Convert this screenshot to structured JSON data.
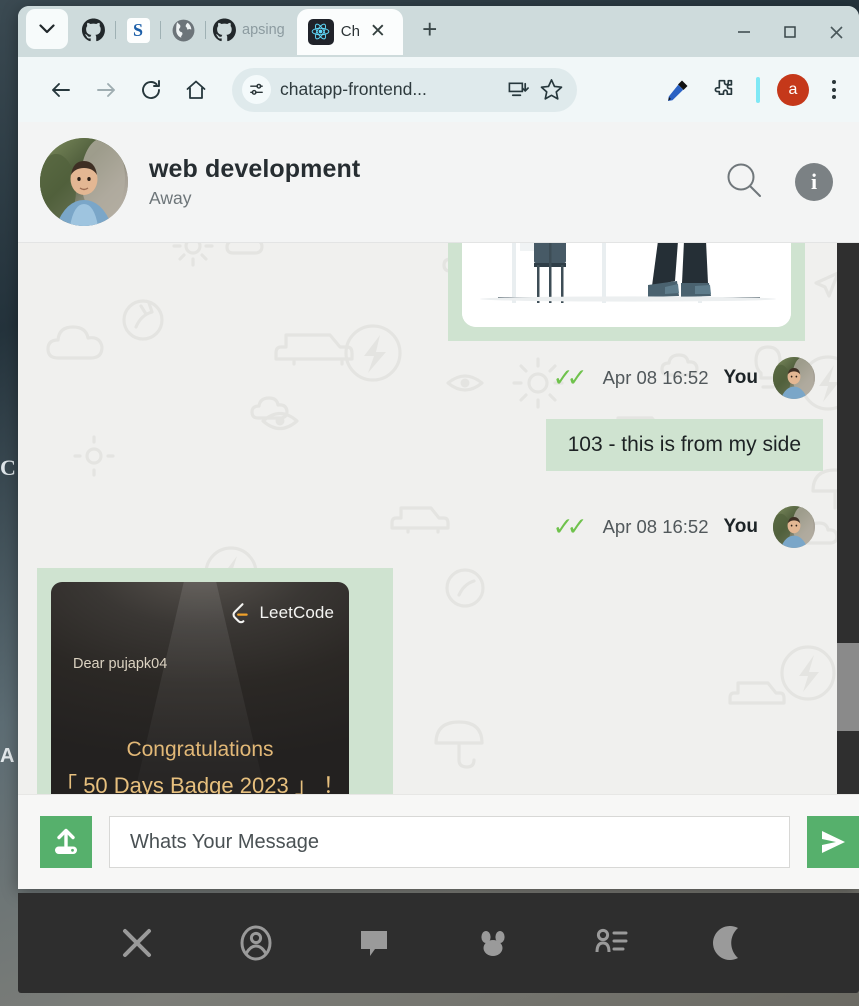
{
  "browser": {
    "tabs": [
      {
        "icon": "github-icon",
        "label": ""
      },
      {
        "icon": "stackoverflow-s-icon",
        "label": ""
      },
      {
        "icon": "globe-icon",
        "label": ""
      },
      {
        "icon": "github-icon",
        "label": "apsing"
      }
    ],
    "active_tab": {
      "icon": "react-icon",
      "label": "Ch"
    },
    "tab_list_icon": "chevron-down-icon",
    "new_tab_label": "+",
    "window_controls": {
      "minimize": "−",
      "maximize": "□",
      "close": "✕"
    },
    "toolbar": {
      "back_icon": "arrow-left-icon",
      "forward_icon": "arrow-right-icon",
      "reload_icon": "reload-icon",
      "home_icon": "home-icon",
      "site_settings_icon": "tune-sliders-icon",
      "url": "chatapp-frontend...",
      "install_icon": "install-app-icon",
      "bookmark_icon": "star-icon",
      "eyedropper_icon": "eyedropper-pen-icon",
      "extensions_icon": "puzzle-piece-icon",
      "profile_initial": "a",
      "menu_icon": "three-dots-icon"
    }
  },
  "desktop": {
    "left_glyph_top": "C",
    "left_glyph_bottom": "A",
    "right_glyph": "@"
  },
  "chat": {
    "header": {
      "title": "web development",
      "status": "Away",
      "search_icon": "search-icon",
      "info_icon": "info-icon"
    },
    "messages": [
      {
        "type": "image",
        "direction": "out",
        "alt": "illustration of chair and standing person legs",
        "time": "Apr 08 16:52",
        "sender": "You",
        "ticks": "✓✓"
      },
      {
        "type": "text",
        "direction": "out",
        "text": "103 - this is from my side",
        "time": "Apr 08 16:52",
        "sender": "You",
        "ticks": "✓✓"
      },
      {
        "type": "image-card",
        "direction": "in",
        "card": {
          "brand": "LeetCode",
          "greeting": "Dear pujapk04",
          "congrats": "Congratulations",
          "badge": "「 50 Days Badge 2023 」 ！"
        }
      }
    ],
    "composer": {
      "upload_icon": "upload-icon",
      "placeholder": "Whats Your Message",
      "value": "",
      "send_icon": "send-icon"
    }
  },
  "dock": {
    "items": [
      {
        "icon": "close-x-icon",
        "name": "close"
      },
      {
        "icon": "user-circle-icon",
        "name": "profile"
      },
      {
        "icon": "chat-bubble-icon",
        "name": "chats"
      },
      {
        "icon": "group-people-icon",
        "name": "groups"
      },
      {
        "icon": "contact-list-icon",
        "name": "contacts"
      },
      {
        "icon": "moon-icon",
        "name": "dark-mode"
      }
    ]
  },
  "colors": {
    "accent_green": "#56b06c",
    "bubble_out": "#cfe3d0",
    "tick_green": "#6fc24c",
    "dock_bg": "#2e2e2e",
    "profile_red": "#c5381a"
  }
}
